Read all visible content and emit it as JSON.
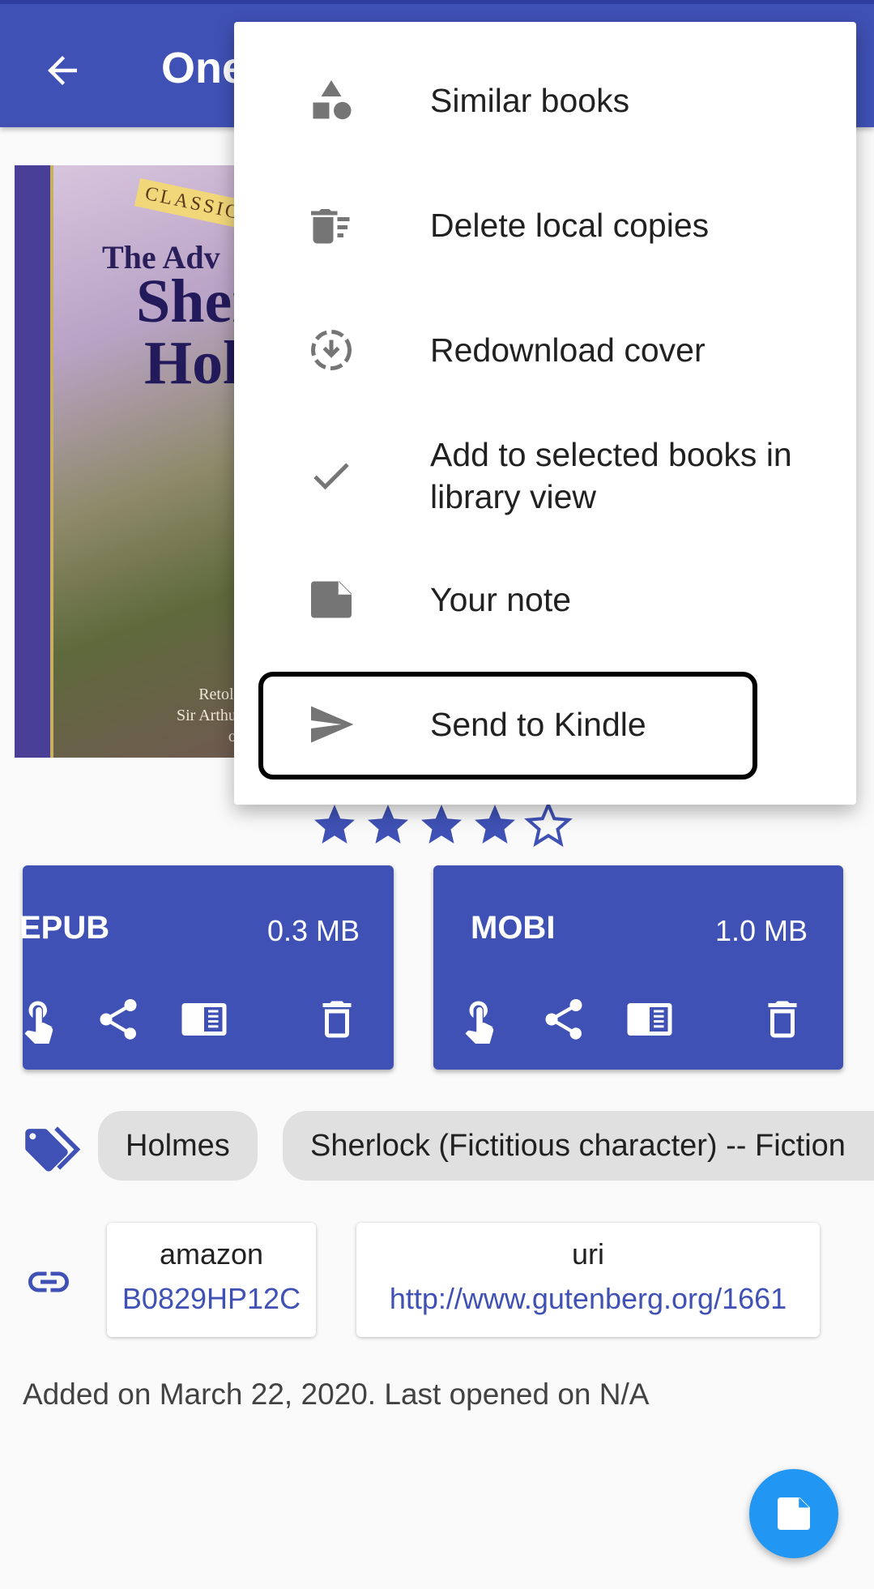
{
  "appbar": {
    "title": "One",
    "back_icon": "arrow-left-icon",
    "color": "#3f51b5"
  },
  "cover": {
    "banner": "CLASSIC",
    "line1": "The Adv",
    "line2": "Sher",
    "line3": "Hol",
    "credit1": "Retold",
    "credit2": "Sir Arthur",
    "credit3": "or"
  },
  "rating": {
    "value": 4,
    "max": 5,
    "color": "#3f51b5"
  },
  "formats": [
    {
      "format": "EPUB",
      "size": "0.3 MB"
    },
    {
      "format": "MOBI",
      "size": "1.0 MB"
    }
  ],
  "tags": {
    "icon": "tags-icon",
    "items": [
      "Holmes",
      "Sherlock (Fictitious character) -- Fiction"
    ]
  },
  "links": {
    "icon": "link-icon",
    "items": [
      {
        "key": "amazon",
        "value": "B0829HP12C"
      },
      {
        "key": "uri",
        "value": "http://www.gutenberg.org/1661"
      }
    ]
  },
  "added": "Added on March 22, 2020. Last opened on N/A",
  "fab": {
    "icon": "note-icon",
    "color": "#2196f3"
  },
  "menu": {
    "items": [
      {
        "label": "Similar books",
        "icon": "shapes-icon"
      },
      {
        "label": "Delete local copies",
        "icon": "delete-sweep-icon"
      },
      {
        "label": "Redownload cover",
        "icon": "download-circle-dashed-icon"
      },
      {
        "label": "Add to selected books in library view",
        "icon": "check-icon"
      },
      {
        "label": "Your note",
        "icon": "note-icon"
      },
      {
        "label": "Send to Kindle",
        "icon": "send-icon",
        "highlighted": true
      }
    ]
  }
}
